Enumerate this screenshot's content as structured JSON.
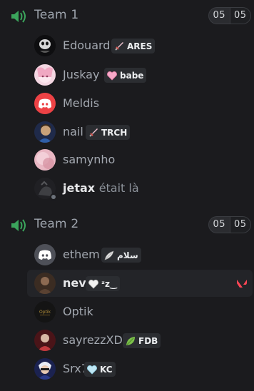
{
  "channels": [
    {
      "name": "Team 1",
      "user_limit": {
        "current": "05",
        "max": "05"
      },
      "members": [
        {
          "name": "Edouard",
          "tag": {
            "label": "ARES",
            "icon": "sword-icon"
          },
          "avatar": "dark-mask"
        },
        {
          "name": "Juskay",
          "tag": {
            "label": "babe",
            "icon": "pink-heart-icon"
          },
          "avatar": "pink-anime"
        },
        {
          "name": "Meldis",
          "avatar": "discord-red"
        },
        {
          "name": "nail",
          "tag": {
            "label": "TRCH",
            "icon": "sword-icon"
          },
          "avatar": "blue-portrait"
        },
        {
          "name": "samynho",
          "avatar": "pink-blur"
        },
        {
          "name": "jetax",
          "suffix": "était là",
          "avatar": "dark-idle"
        }
      ]
    },
    {
      "name": "Team 2",
      "user_limit": {
        "current": "05",
        "max": "05"
      },
      "members": [
        {
          "name": "ethem",
          "tag": {
            "label": "سلام",
            "icon": "feather-icon"
          },
          "avatar": "discord-gray"
        },
        {
          "name": "nev",
          "tag": {
            "label": "ᶻz‿",
            "icon": "white-heart-icon"
          },
          "avatar": "brown-figure",
          "side_icon": "valorant-icon"
        },
        {
          "name": "Optik",
          "avatar": "optik-logo"
        },
        {
          "name": "sayrezzXD",
          "tag": {
            "label": "FDB",
            "icon": "leaf-icon"
          },
          "avatar": "red-portrait"
        },
        {
          "name": "Srx7",
          "tag": {
            "label": "KC",
            "icon": "light-blue-heart-icon"
          },
          "avatar": "blue-gojo"
        }
      ]
    }
  ],
  "colors": {
    "background": "#1b1b1e",
    "voice_icon": "#3ba55c",
    "discord_red": "#ed4245",
    "discord_gray": "#4e5058",
    "valorant": "#ff4655"
  }
}
